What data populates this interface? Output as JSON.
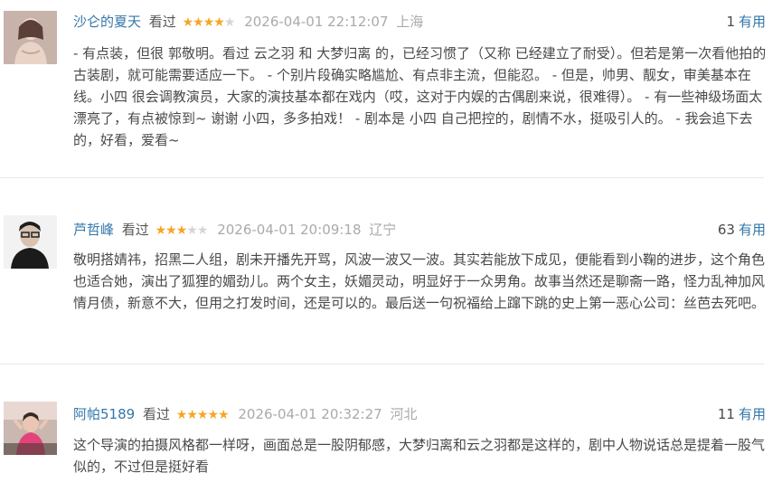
{
  "reviews": [
    {
      "username": "沙仑的夏天",
      "watched_label": "看过",
      "rating": 4,
      "datetime": "2026-04-01 22:12:07",
      "location": "上海",
      "useful_count": "1",
      "useful_label": "有用",
      "content": "- 有点装，但很 郭敬明。看过 云之羽 和 大梦归离 的，已经习惯了（又称 已经建立了耐受）。但若是第一次看他拍的古装剧，就可能需要适应一下。 - 个别片段确实略尴尬、有点非主流，但能忍。 - 但是，帅男、靓女，审美基本在线。小四 很会调教演员，大家的演技基本都在戏内（哎，这对于内娱的古偶剧来说，很难得）。 - 有一些神级场面太漂亮了，有点被惊到~ 谢谢 小四，多多拍戏！ - 剧本是 小四 自己把控的，剧情不水，挺吸引人的。 - 我会追下去的，好看，爱看~"
    },
    {
      "username": "芦哲峰",
      "watched_label": "看过",
      "rating": 3,
      "datetime": "2026-04-01 20:09:18",
      "location": "辽宁",
      "useful_count": "63",
      "useful_label": "有用",
      "content": "敬明搭婧祎，招黑二人组，剧未开播先开骂，风波一波又一波。其实若能放下成见，便能看到小鞠的进步，这个角色也适合她，演出了狐狸的媚劲儿。两个女主，妖媚灵动，明显好于一众男角。故事当然还是聊斋一路，怪力乱神加风情月债，新意不大，但用之打发时间，还是可以的。最后送一句祝福给上蹿下跳的史上第一恶心公司：丝芭去死吧。"
    },
    {
      "username": "阿帕5189",
      "watched_label": "看过",
      "rating": 5,
      "datetime": "2026-04-01 20:32:27",
      "location": "河北",
      "useful_count": "11",
      "useful_label": "有用",
      "content": "这个导演的拍摄风格都一样呀，画面总是一股阴郁感，大梦归离和云之羽都是这样的，剧中人物说话总是提着一股气似的，不过但是挺好看"
    }
  ]
}
